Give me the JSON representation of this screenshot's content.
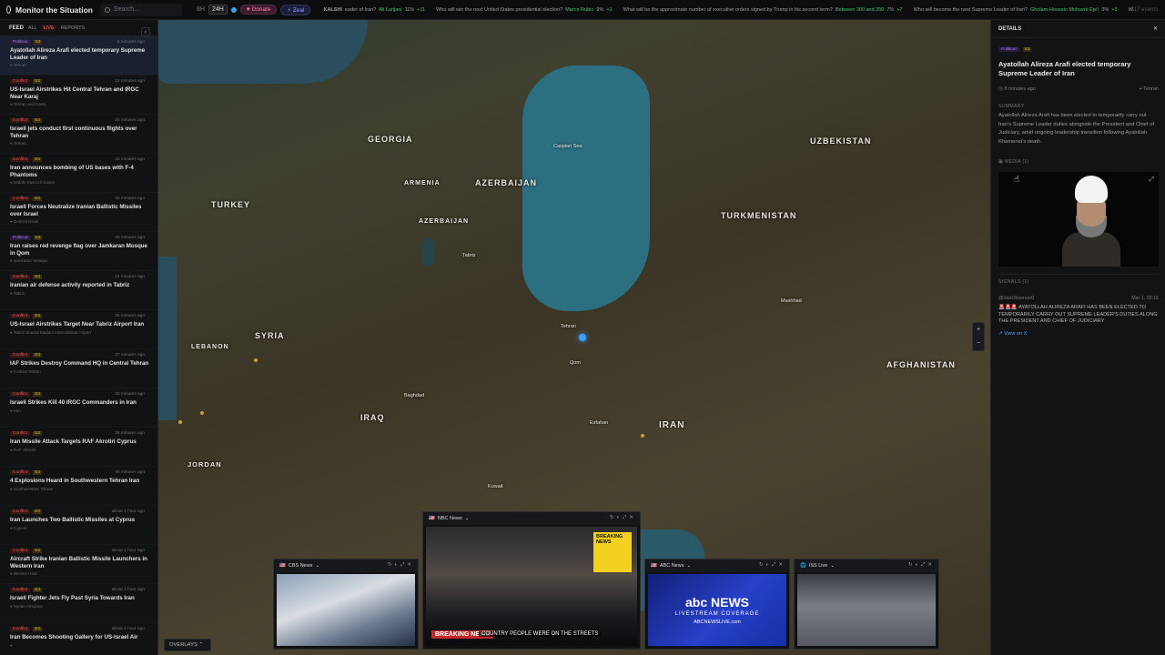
{
  "app": {
    "title": "Monitor the Situation"
  },
  "search": {
    "placeholder": "Search..."
  },
  "topbar": {
    "range_label": "8H",
    "range_selected": "24H",
    "donate": "Donate",
    "zeal": "Zeal",
    "item_count": "117 events",
    "ticker": [
      {
        "tag": "KALSHI",
        "text": "eader of Iran?",
        "name": "Ali Larijani",
        "pct": "11%",
        "chg": "+11",
        "up": true
      },
      {
        "tag": "",
        "text": "Who will win the next United States presidential election?",
        "name": "Marco Rubio",
        "pct": "9%",
        "chg": "+1",
        "up": true
      },
      {
        "tag": "",
        "text": "What will be the approximate number of executive orders signed by Trump in his second term?",
        "name": "Between 300 and 350",
        "pct": "7%",
        "chg": "+7",
        "up": true
      },
      {
        "tag": "",
        "text": "Who will become the next Supreme Leader of Iran?",
        "name": "Gholam-Hossein Mohseni-Eje'i",
        "pct": "3%",
        "chg": "+3",
        "up": true
      },
      {
        "tag": "",
        "text": "Will Donald Trump ce",
        "name": "",
        "pct": "",
        "chg": "",
        "up": true
      }
    ]
  },
  "feed": {
    "title": "FEED",
    "tabs": [
      "ALL",
      "LIVE",
      "REPORTS"
    ],
    "items": [
      {
        "category": "Political",
        "sev": "S3",
        "time": "8 minutes ago",
        "title": "Ayatollah Alireza Arafi elected temporary Supreme Leader of Iran",
        "loc": "Tehran"
      },
      {
        "category": "Conflict",
        "sev": "S3",
        "time": "12 minutes ago",
        "title": "US-Israel Airstrikes Hit Central Tehran and IRGC Near Karaj",
        "loc": "Tehran and Karaj"
      },
      {
        "category": "Conflict",
        "sev": "S4",
        "time": "15 minutes ago",
        "title": "Israeli jets conduct first continuous flights over Tehran",
        "loc": "Tehran"
      },
      {
        "category": "Conflict",
        "sev": "S3",
        "time": "15 minutes ago",
        "title": "Iran announces bombing of US bases with F-4 Phantoms",
        "loc": "Middle East US bases"
      },
      {
        "category": "Conflict",
        "sev": "S3",
        "time": "16 minutes ago",
        "title": "Israeli Forces Neutralize Iranian Ballistic Missiles over Israel",
        "loc": "Central Israel"
      },
      {
        "category": "Political",
        "sev": "S3",
        "time": "20 minutes ago",
        "title": "Iran raises red revenge flag over Jamkaran Mosque in Qom",
        "loc": "Jamkaran Mosque"
      },
      {
        "category": "Conflict",
        "sev": "S3",
        "time": "24 minutes ago",
        "title": "Iranian air defense activity reported in Tabriz",
        "loc": "Tabriz"
      },
      {
        "category": "Conflict",
        "sev": "S3",
        "time": "26 minutes ago",
        "title": "US-Israel Airstrikes Target Near Tabriz Airport Iran",
        "loc": "Tabriz Shahid Madani International Airport"
      },
      {
        "category": "Conflict",
        "sev": "S3",
        "time": "27 minutes ago",
        "title": "IAF Strikes Destroy Command HQ in Central Tehran",
        "loc": "Central Tehran"
      },
      {
        "category": "Conflict",
        "sev": "S3",
        "time": "33 minutes ago",
        "title": "Israeli Strikes Kill 40 IRGC Commanders in Iran",
        "loc": "Iran"
      },
      {
        "category": "Conflict",
        "sev": "S3",
        "time": "36 minutes ago",
        "title": "Iran Missile Attack Targets RAF Akrotiri Cyprus",
        "loc": "RAF Akrotiri"
      },
      {
        "category": "Conflict",
        "sev": "S4",
        "time": "40 minutes ago",
        "title": "4 Explosions Heard in Southwestern Tehran Iran",
        "loc": "Southwestern Tehran"
      },
      {
        "category": "Conflict",
        "sev": "S3",
        "time": "about 1 hour ago",
        "title": "Iran Launches Two Ballistic Missiles at Cyprus",
        "loc": "Cyprus"
      },
      {
        "category": "Conflict",
        "sev": "S3",
        "time": "about 1 hour ago",
        "title": "Aircraft Strike Iranian Ballistic Missile Launchers in Western Iran",
        "loc": "Western Iran"
      },
      {
        "category": "Conflict",
        "sev": "S3",
        "time": "about 1 hour ago",
        "title": "Israeli Fighter Jets Fly Past Syria Towards Iran",
        "loc": "Syrian Airspace"
      },
      {
        "category": "Conflict",
        "sev": "S4",
        "time": "about 1 hour ago",
        "title": "Iran Becomes Shooting Gallery for US-Israel Air",
        "loc": ""
      }
    ]
  },
  "map": {
    "labels": {
      "georgia": "GEORGIA",
      "armenia": "ARMENIA",
      "azerbaijan": "AZERBAIJAN",
      "azerbaijan2": "AZERBAIJAN",
      "turkey": "TURKEY",
      "syria": "SYRIA",
      "lebanon": "LEBANON",
      "iraq": "IRAQ",
      "jordan": "JORDAN",
      "iran": "IRAN",
      "turkmenistan": "TURKMENISTAN",
      "uzbekistan": "UZBEKISTAN",
      "afghanistan": "AFGHANISTAN",
      "tehran": "Tehran",
      "tabriz": "Tabriz",
      "qom": "Qom",
      "isfahan": "Esfahan",
      "baghdad": "Baghdad",
      "caspian": "Caspian Sea",
      "mashhad": "Mashhad",
      "kuwait": "Kuwait"
    },
    "overlays_label": "OVERLAYS",
    "zoom_in": "+",
    "zoom_out": "−"
  },
  "streams": {
    "cbs": {
      "name": "CBS News"
    },
    "nbc": {
      "name": "NBC News",
      "breaking": "BREAKING NEWS",
      "caption": "COUNTRY PEOPLE WERE ON THE STREETS",
      "side": "BREAKING NEWS"
    },
    "abc": {
      "name": "ABC News",
      "logo": "abc NEWS",
      "line1": "LIVESTREAM COVERAGE",
      "line2": "ABCNEWSLIVE.com"
    },
    "iss": {
      "name": "ISS Live"
    }
  },
  "details": {
    "header": "DETAILS",
    "category": "Political",
    "sev": "S3",
    "title": "Ayatollah Alireza Arafi elected temporary Supreme Leader of Iran",
    "time": "8 minutes ago",
    "location": "Tehran",
    "summary_label": "SUMMARY",
    "summary": "Ayatollah Alireza Arafi has been elected to temporarily carry out Iran's Supreme Leader duties alongside the President and Chief of Judiciary, amid ongoing leadership transition following Ayatollah Khamenei's death.",
    "media_label": "MEDIA (1)",
    "signals_label": "SIGNALS (1)",
    "signal_handle": "@IranObserver0",
    "signal_time": "Mar 1, 03:16",
    "signal_text": "🚨🚨🚨 AYATOLLAH ALIREZA ARAFI HAS BEEN ELECTED TO TEMPORARILY CARRY OUT SUPREME LEADER'S DUTIES ALONG THE PRESIDENT AND CHIEF OF JUDICIARY",
    "view_on_x": "View on X"
  }
}
